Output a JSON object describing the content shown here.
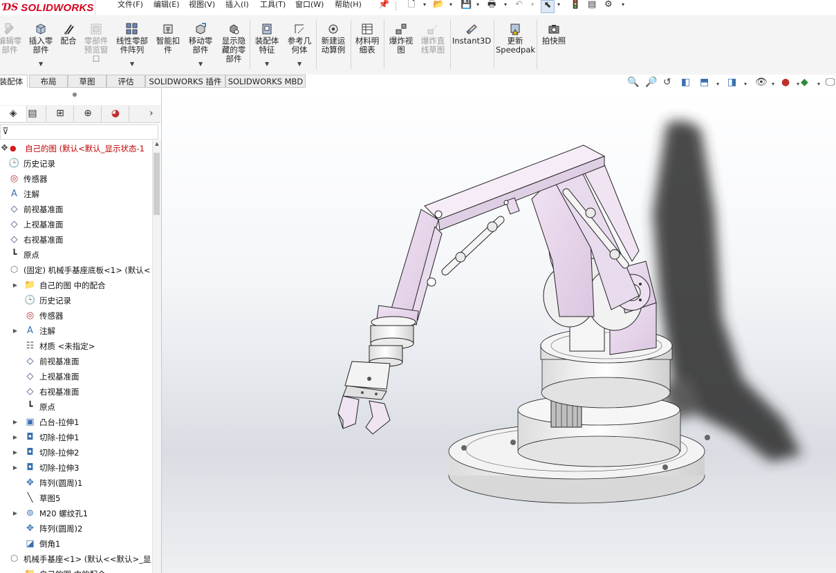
{
  "app": {
    "logo_prefix": "ƊS",
    "logo_text": "SOLIDWORKS"
  },
  "menubar": {
    "items": [
      "文件(F)",
      "编辑(E)",
      "视图(V)",
      "插入(I)",
      "工具(T)",
      "窗口(W)",
      "帮助(H)"
    ],
    "pin_icon": "pin-icon"
  },
  "quick_access": {
    "icons": [
      "new-document-icon",
      "open-icon",
      "save-icon",
      "print-icon",
      "undo-icon",
      "select-icon",
      "rebuild-icon",
      "file-properties-icon",
      "options-icon"
    ]
  },
  "ribbon": {
    "buttons": [
      {
        "label": "编辑零\n部件",
        "enabled": false,
        "icon": "edit-component-icon"
      },
      {
        "label": "插入零\n部件",
        "enabled": true,
        "icon": "insert-component-icon",
        "dropdown": true
      },
      {
        "label": "配合",
        "enabled": true,
        "icon": "mate-icon"
      },
      {
        "label": "零部件\n预览窗\n口",
        "enabled": false,
        "icon": "component-preview-icon"
      },
      {
        "label": "线性零部\n件阵列",
        "enabled": true,
        "icon": "linear-pattern-icon",
        "dropdown": true
      },
      {
        "label": "智能扣\n件",
        "enabled": true,
        "icon": "smart-fasteners-icon"
      },
      {
        "label": "移动零\n部件",
        "enabled": true,
        "icon": "move-component-icon",
        "dropdown": true
      },
      {
        "label": "显示隐\n藏的零\n部件",
        "enabled": true,
        "icon": "show-hidden-icon"
      },
      {
        "label": "装配体\n特征",
        "enabled": true,
        "icon": "assembly-features-icon",
        "dropdown": true
      },
      {
        "label": "参考几\n何体",
        "enabled": true,
        "icon": "reference-geometry-icon",
        "dropdown": true
      },
      {
        "label": "新建运\n动算例",
        "enabled": true,
        "icon": "new-motion-study-icon"
      },
      {
        "label": "材料明\n细表",
        "enabled": true,
        "icon": "bill-of-materials-icon"
      },
      {
        "label": "爆炸视\n图",
        "enabled": true,
        "icon": "exploded-view-icon"
      },
      {
        "label": "爆炸直\n线草图",
        "enabled": false,
        "icon": "explode-line-sketch-icon"
      },
      {
        "label": "Instant3D",
        "enabled": true,
        "icon": "instant3d-icon"
      },
      {
        "label": "更新\nSpeedpak",
        "enabled": true,
        "icon": "update-speedpak-icon"
      },
      {
        "label": "拍快照",
        "enabled": true,
        "icon": "snapshot-icon"
      }
    ]
  },
  "tabs": [
    {
      "label": "装配体",
      "active": true
    },
    {
      "label": "布局",
      "active": false
    },
    {
      "label": "草图",
      "active": false
    },
    {
      "label": "评估",
      "active": false
    },
    {
      "label": "SOLIDWORKS 插件",
      "active": false
    },
    {
      "label": "SOLIDWORKS MBD",
      "active": false
    }
  ],
  "heads_up_toolbar": {
    "icons": [
      "zoom-to-fit-icon",
      "zoom-to-area-icon",
      "previous-view-icon",
      "section-view-icon",
      "view-orientation-icon",
      "display-style-icon",
      "hide-show-items-icon",
      "edit-appearance-icon",
      "apply-scene-icon",
      "view-settings-icon"
    ]
  },
  "feature_manager": {
    "panel_tabs": [
      "featuremanager-tab",
      "propertymanager-tab",
      "configurationmanager-tab",
      "dimxpert-tab",
      "display-manager-tab"
    ],
    "filter_icon": "filter-icon",
    "tree": [
      {
        "label": "自己的图  (默认<默认_显示状态-1",
        "icon": "assembly-icon",
        "depth": 0,
        "root": true
      },
      {
        "label": "历史记录",
        "icon": "history-icon",
        "depth": 1
      },
      {
        "label": "传感器",
        "icon": "sensor-icon",
        "depth": 1
      },
      {
        "label": "注解",
        "icon": "annotation-icon",
        "depth": 1
      },
      {
        "label": "前视基准面",
        "icon": "plane-icon",
        "depth": 1
      },
      {
        "label": "上视基准面",
        "icon": "plane-icon",
        "depth": 1
      },
      {
        "label": "右视基准面",
        "icon": "plane-icon",
        "depth": 1
      },
      {
        "label": "原点",
        "icon": "origin-icon",
        "depth": 1
      },
      {
        "label": "(固定) 机械手基座底板<1> (默认<",
        "icon": "part-icon",
        "depth": 1
      },
      {
        "label": "自己的图 中的配合",
        "icon": "mates-folder-icon",
        "depth": 2,
        "expander": true
      },
      {
        "label": "历史记录",
        "icon": "history-icon",
        "depth": 2
      },
      {
        "label": "传感器",
        "icon": "sensor-icon",
        "depth": 2
      },
      {
        "label": "注解",
        "icon": "annotation-icon",
        "depth": 2,
        "expander": true
      },
      {
        "label": "材质 <未指定>",
        "icon": "material-icon",
        "depth": 2
      },
      {
        "label": "前视基准面",
        "icon": "plane-icon",
        "depth": 2
      },
      {
        "label": "上视基准面",
        "icon": "plane-icon",
        "depth": 2
      },
      {
        "label": "右视基准面",
        "icon": "plane-icon",
        "depth": 2
      },
      {
        "label": "原点",
        "icon": "origin-icon",
        "depth": 2
      },
      {
        "label": "凸台-拉伸1",
        "icon": "boss-extrude-icon",
        "depth": 2,
        "expander": true
      },
      {
        "label": "切除-拉伸1",
        "icon": "cut-extrude-icon",
        "depth": 2,
        "expander": true
      },
      {
        "label": "切除-拉伸2",
        "icon": "cut-extrude-icon",
        "depth": 2,
        "expander": true
      },
      {
        "label": "切除-拉伸3",
        "icon": "cut-extrude-icon",
        "depth": 2,
        "expander": true
      },
      {
        "label": "阵列(圆周)1",
        "icon": "circular-pattern-icon",
        "depth": 2
      },
      {
        "label": "草图5",
        "icon": "sketch-icon",
        "depth": 2
      },
      {
        "label": "M20 螺纹孔1",
        "icon": "hole-wizard-icon",
        "depth": 2,
        "expander": true
      },
      {
        "label": "阵列(圆周)2",
        "icon": "circular-pattern-icon",
        "depth": 2
      },
      {
        "label": "倒角1",
        "icon": "chamfer-icon",
        "depth": 2
      },
      {
        "label": "机械手基座<1> (默认<<默认>_显",
        "icon": "part-icon",
        "depth": 1
      },
      {
        "label": "自己的图 中的配合",
        "icon": "mates-folder-icon",
        "depth": 2
      }
    ]
  },
  "graphics": {
    "model_name": "robot-arm-assembly",
    "part_color": "#ecdcf0",
    "base_color": "#f3f3f3"
  }
}
